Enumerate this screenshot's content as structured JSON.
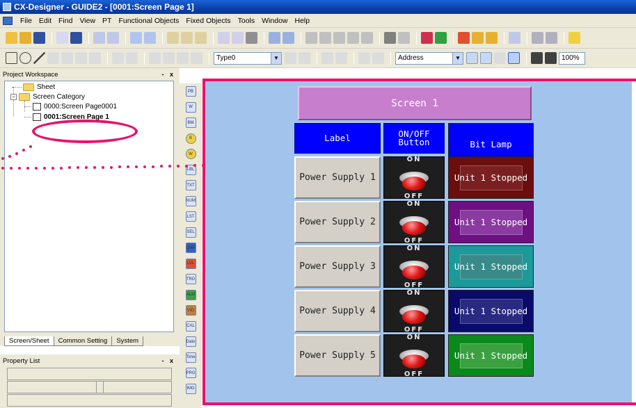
{
  "window": {
    "title": "CX-Designer - GUIDE2 - [0001:Screen Page 1]"
  },
  "menu": [
    "File",
    "Edit",
    "Find",
    "View",
    "PT",
    "Functional Objects",
    "Fixed Objects",
    "Tools",
    "Window",
    "Help"
  ],
  "toolbar2": {
    "type_combo": "Type0",
    "address_combo": "Address",
    "zoom": "100%"
  },
  "workspace": {
    "header": "Project Workspace",
    "header_controls": "- x",
    "tree": {
      "sheet": "Sheet",
      "category": "Screen Category",
      "page0": "0000:Screen Page0001",
      "page1": "0001:Screen Page 1"
    },
    "tabs": [
      "Screen/Sheet",
      "Common Setting",
      "System"
    ]
  },
  "properties": {
    "header": "Property List",
    "header_controls": "- x"
  },
  "palette": [
    "PB",
    "W",
    "BM",
    "B",
    "W",
    "LBL",
    "TXT",
    "NUM",
    "LST",
    "SEL",
    "LMP",
    "LVL",
    "TRD",
    "ALM",
    "VID",
    "CAL",
    "Date",
    "Time",
    "PRG",
    "IMG"
  ],
  "screen": {
    "title": "Screen 1",
    "headers": {
      "label": "Label",
      "onoff": "ON/OFF\nButton",
      "lamp": "Bit Lamp"
    },
    "rows": [
      {
        "label": "Power Supply 1",
        "on": "ON",
        "off": "OFF",
        "lamp_text": "Unit 1 Stopped",
        "lamp_color": "#6a0e0e"
      },
      {
        "label": "Power Supply 2",
        "on": "ON",
        "off": "OFF",
        "lamp_text": "Unit 1 Stopped",
        "lamp_color": "#6e0f82"
      },
      {
        "label": "Power Supply 3",
        "on": "ON",
        "off": "OFF",
        "lamp_text": "Unit 1 Stopped",
        "lamp_color": "#1c9a9a"
      },
      {
        "label": "Power Supply 4",
        "on": "ON",
        "off": "OFF",
        "lamp_text": "Unit 1 Stopped",
        "lamp_color": "#0a0a6a"
      },
      {
        "label": "Power Supply 5",
        "on": "ON",
        "off": "OFF",
        "lamp_text": "Unit 1 Stopped",
        "lamp_color": "#0a8a1a"
      }
    ]
  },
  "colors": {
    "accent": "#e8136c",
    "canvas": "#a2c4ec",
    "header_blue": "#0000ff",
    "title_purple": "#c77fcd"
  }
}
